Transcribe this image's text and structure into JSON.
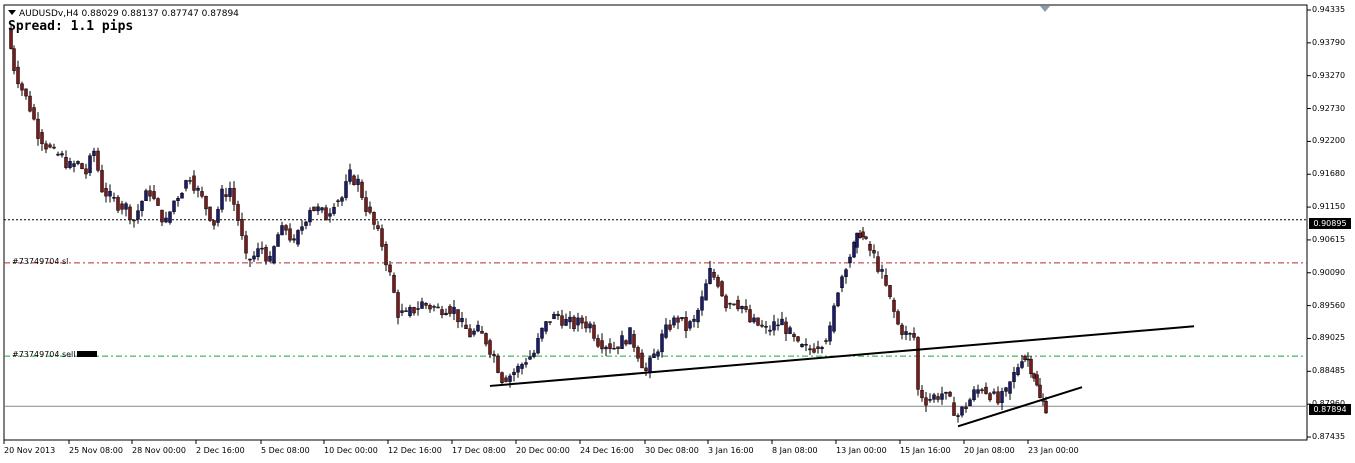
{
  "chart_header": {
    "symbol_info": "AUDUSDv,H4  0.88029 0.88137 0.87747 0.87894",
    "spread": "Spread: 1.1 pips"
  },
  "orders": {
    "sl_label": "#73749704 sl",
    "sell_label": "#73749704 sell"
  },
  "price_axis": [
    "0.94335",
    "0.93790",
    "0.93270",
    "0.92730",
    "0.92200",
    "0.91680",
    "0.91150",
    "0.90615",
    "0.90090",
    "0.89560",
    "0.89025",
    "0.88485",
    "0.87960",
    "0.87435"
  ],
  "marked_prices": {
    "horizontal_line": "0.90895",
    "current_bid": "0.87894"
  },
  "time_axis": [
    "20 Nov 2013",
    "25 Nov 08:00",
    "28 Nov 00:00",
    "2 Dec 16:00",
    "5 Dec 08:00",
    "10 Dec 00:00",
    "12 Dec 16:00",
    "17 Dec 08:00",
    "20 Dec 00:00",
    "24 Dec 16:00",
    "30 Dec 08:00",
    "3 Jan 16:00",
    "8 Jan 08:00",
    "13 Jan 00:00",
    "15 Jan 16:00",
    "20 Jan 08:00",
    "23 Jan 00:00"
  ],
  "colors": {
    "bull_candle": "#1a1a6e",
    "bear_candle": "#7a1a1a",
    "sl_line": "#b03030",
    "sell_line": "#20a040",
    "trend_line": "#000000"
  },
  "chart_data": {
    "type": "candlestick",
    "symbol": "AUDUSDv",
    "timeframe": "H4",
    "ylim": [
      0.8735,
      0.9435
    ],
    "close_path": [
      [
        0,
        0.9395
      ],
      [
        6,
        0.9335
      ],
      [
        14,
        0.93
      ],
      [
        22,
        0.927
      ],
      [
        30,
        0.923
      ],
      [
        38,
        0.921
      ],
      [
        46,
        0.9195
      ],
      [
        54,
        0.919
      ],
      [
        62,
        0.9175
      ],
      [
        70,
        0.918
      ],
      [
        78,
        0.9165
      ],
      [
        86,
        0.92
      ],
      [
        94,
        0.914
      ],
      [
        102,
        0.9125
      ],
      [
        110,
        0.9115
      ],
      [
        118,
        0.911
      ],
      [
        126,
        0.909
      ],
      [
        134,
        0.912
      ],
      [
        142,
        0.9135
      ],
      [
        150,
        0.9105
      ],
      [
        158,
        0.9085
      ],
      [
        166,
        0.912
      ],
      [
        174,
        0.914
      ],
      [
        182,
        0.916
      ],
      [
        190,
        0.9135
      ],
      [
        198,
        0.911
      ],
      [
        206,
        0.9085
      ],
      [
        214,
        0.913
      ],
      [
        222,
        0.914
      ],
      [
        230,
        0.909
      ],
      [
        238,
        0.9025
      ],
      [
        246,
        0.903
      ],
      [
        254,
        0.9045
      ],
      [
        262,
        0.902
      ],
      [
        270,
        0.9065
      ],
      [
        278,
        0.9075
      ],
      [
        286,
        0.905
      ],
      [
        294,
        0.908
      ],
      [
        302,
        0.911
      ],
      [
        310,
        0.9105
      ],
      [
        318,
        0.9095
      ],
      [
        326,
        0.912
      ],
      [
        334,
        0.9125
      ],
      [
        342,
        0.916
      ],
      [
        350,
        0.915
      ],
      [
        358,
        0.911
      ],
      [
        366,
        0.908
      ],
      [
        374,
        0.905
      ],
      [
        382,
        0.9
      ],
      [
        390,
        0.894
      ],
      [
        398,
        0.8935
      ],
      [
        406,
        0.8945
      ],
      [
        414,
        0.8955
      ],
      [
        422,
        0.895
      ],
      [
        430,
        0.8945
      ],
      [
        438,
        0.895
      ],
      [
        446,
        0.8945
      ],
      [
        454,
        0.892
      ],
      [
        462,
        0.8905
      ],
      [
        470,
        0.891
      ],
      [
        478,
        0.8895
      ],
      [
        486,
        0.887
      ],
      [
        494,
        0.8835
      ],
      [
        502,
        0.884
      ],
      [
        510,
        0.885
      ],
      [
        518,
        0.8865
      ],
      [
        526,
        0.8875
      ],
      [
        534,
        0.891
      ],
      [
        542,
        0.893
      ],
      [
        550,
        0.8935
      ],
      [
        558,
        0.8925
      ],
      [
        566,
        0.892
      ],
      [
        574,
        0.8925
      ],
      [
        582,
        0.892
      ],
      [
        590,
        0.8895
      ],
      [
        598,
        0.889
      ],
      [
        606,
        0.8885
      ],
      [
        614,
        0.8895
      ],
      [
        622,
        0.8905
      ],
      [
        630,
        0.8875
      ],
      [
        638,
        0.8845
      ],
      [
        646,
        0.887
      ],
      [
        654,
        0.89
      ],
      [
        662,
        0.892
      ],
      [
        670,
        0.893
      ],
      [
        678,
        0.8915
      ],
      [
        686,
        0.8925
      ],
      [
        694,
        0.896
      ],
      [
        702,
        0.9005
      ],
      [
        710,
        0.899
      ],
      [
        718,
        0.8955
      ],
      [
        726,
        0.896
      ],
      [
        734,
        0.895
      ],
      [
        742,
        0.8925
      ],
      [
        750,
        0.892
      ],
      [
        758,
        0.891
      ],
      [
        766,
        0.892
      ],
      [
        774,
        0.8925
      ],
      [
        782,
        0.8905
      ],
      [
        790,
        0.8885
      ],
      [
        798,
        0.888
      ],
      [
        806,
        0.8885
      ],
      [
        814,
        0.8895
      ],
      [
        822,
        0.891
      ],
      [
        830,
        0.898
      ],
      [
        838,
        0.902
      ],
      [
        846,
        0.9045
      ],
      [
        852,
        0.907
      ],
      [
        858,
        0.905
      ],
      [
        866,
        0.903
      ],
      [
        874,
        0.9
      ],
      [
        882,
        0.896
      ],
      [
        890,
        0.892
      ],
      [
        898,
        0.8905
      ],
      [
        906,
        0.89
      ],
      [
        910,
        0.8815
      ],
      [
        918,
        0.88
      ],
      [
        926,
        0.8805
      ],
      [
        934,
        0.881
      ],
      [
        942,
        0.8795
      ],
      [
        950,
        0.8775
      ],
      [
        958,
        0.879
      ],
      [
        966,
        0.881
      ],
      [
        974,
        0.882
      ],
      [
        982,
        0.881
      ],
      [
        990,
        0.8795
      ],
      [
        998,
        0.881
      ],
      [
        1006,
        0.884
      ],
      [
        1014,
        0.887
      ],
      [
        1020,
        0.8865
      ],
      [
        1026,
        0.884
      ],
      [
        1032,
        0.88
      ],
      [
        1038,
        0.8789
      ]
    ],
    "trend_lines": [
      {
        "from": [
          "17 Dec 08:00",
          0.8822
        ],
        "to": [
          "future",
          0.8918
        ]
      },
      {
        "from": [
          "20 Jan 08:00",
          0.8757
        ],
        "to": [
          "future",
          0.882
        ]
      }
    ],
    "horizontal_levels": [
      {
        "name": "#73749704 sl",
        "value": 0.902
      },
      {
        "name": "#73749704 sell",
        "value": 0.887
      },
      {
        "name": "",
        "value": 0.90895
      },
      {
        "name": "",
        "value": 0.87894
      }
    ]
  }
}
